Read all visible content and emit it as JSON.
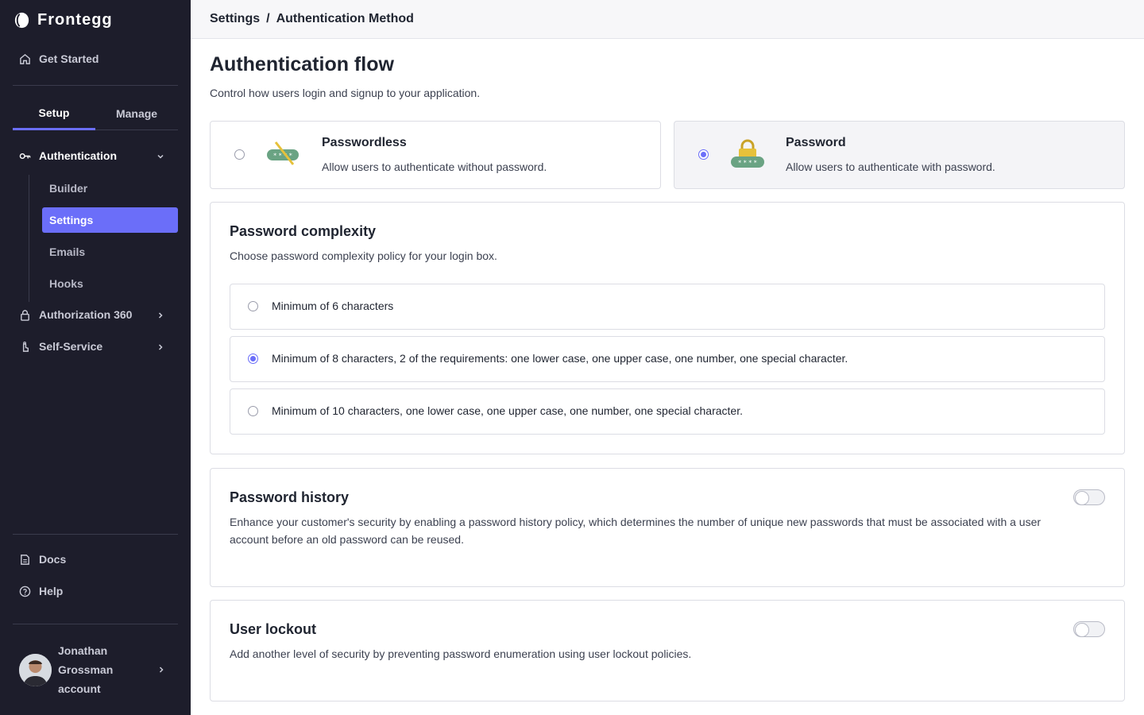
{
  "app": {
    "brand": "Frontegg"
  },
  "sidebar": {
    "get_started": "Get Started",
    "tabs": [
      {
        "label": "Setup",
        "active": true
      },
      {
        "label": "Manage",
        "active": false
      }
    ],
    "authentication": "Authentication",
    "sub_items": [
      {
        "label": "Builder",
        "active": false
      },
      {
        "label": "Settings",
        "active": true
      },
      {
        "label": "Emails",
        "active": false
      },
      {
        "label": "Hooks",
        "active": false
      }
    ],
    "authorization": "Authorization 360",
    "self_service": "Self-Service",
    "docs": "Docs",
    "help": "Help",
    "user_name": "Jonathan Grossman account"
  },
  "header": {
    "crumb_parent": "Settings",
    "crumb_sep": "/",
    "crumb_current": "Authentication Method"
  },
  "main": {
    "title": "Authentication flow",
    "subtitle": "Control how users login and signup to your application.",
    "methods": [
      {
        "title": "Passwordless",
        "desc": "Allow users to authenticate without password.",
        "selected": false
      },
      {
        "title": "Password",
        "desc": "Allow users to authenticate with password.",
        "selected": true
      }
    ],
    "complexity": {
      "title": "Password complexity",
      "desc": "Choose password complexity policy for your login box.",
      "options": [
        "Minimum of 6 characters",
        "Minimum of 8 characters, 2 of the requirements: one lower case, one upper case, one number, one special character.",
        "Minimum of 10 characters, one lower case, one upper case, one number, one special character."
      ],
      "selected_index": 1
    },
    "history": {
      "title": "Password history",
      "desc": "Enhance your customer's security by enabling a password history policy, which determines the number of unique new passwords that must be associated with a user account before an old password can be reused.",
      "enabled": false
    },
    "lockout": {
      "title": "User lockout",
      "desc": "Add another level of security by preventing password enumeration using user lockout policies.",
      "enabled": false
    }
  },
  "colors": {
    "accent": "#6b6ef9",
    "sidebar_bg": "#1d1d2b"
  },
  "icons": [
    "home-icon",
    "key-icon",
    "chevron-down-icon",
    "lock-icon",
    "chevron-right-icon",
    "hand-icon",
    "document-icon",
    "help-icon"
  ]
}
